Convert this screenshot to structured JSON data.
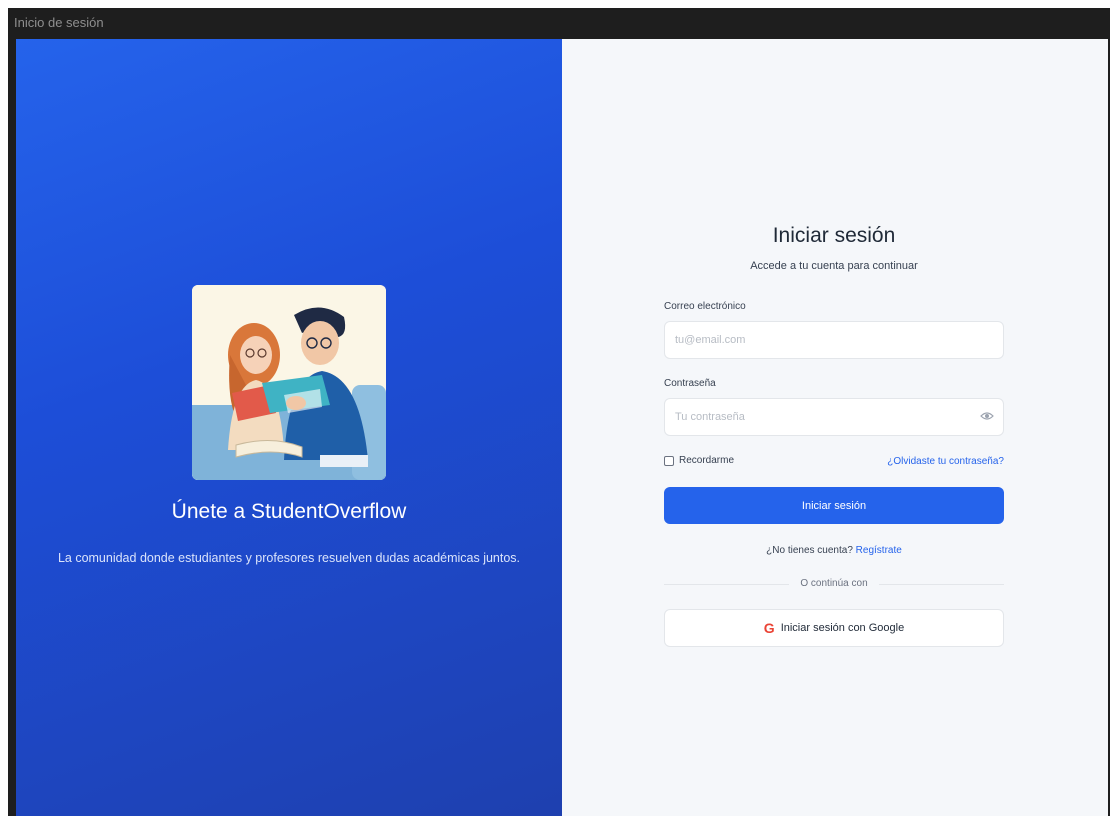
{
  "window": {
    "title": "Inicio de sesión"
  },
  "hero": {
    "title": "Únete a StudentOverflow",
    "subtitle": "La comunidad donde estudiantes y profesores resuelven dudas académicas juntos.",
    "illustration_icon": "students-reading-illustration"
  },
  "form": {
    "title": "Iniciar sesión",
    "subtitle": "Accede a tu cuenta para continuar",
    "email": {
      "label": "Correo electrónico",
      "placeholder": "tu@email.com",
      "value": ""
    },
    "password": {
      "label": "Contraseña",
      "placeholder": "Tu contraseña",
      "value": "",
      "toggle_icon": "eye-icon"
    },
    "remember_label": "Recordarme",
    "forgot_label": "¿Olvidaste tu contraseña?",
    "submit_label": "Iniciar sesión",
    "signup_prompt": "¿No tienes cuenta?",
    "signup_link": "Regístrate",
    "divider_text": "O continúa con",
    "google_icon_glyph": "G",
    "google_label": "Iniciar sesión con Google"
  },
  "colors": {
    "primary": "#2563eb",
    "hero_gradient_start": "#2563eb",
    "hero_gradient_end": "#1e40af",
    "google_red": "#ea4335",
    "right_bg": "#f5f7fa"
  }
}
